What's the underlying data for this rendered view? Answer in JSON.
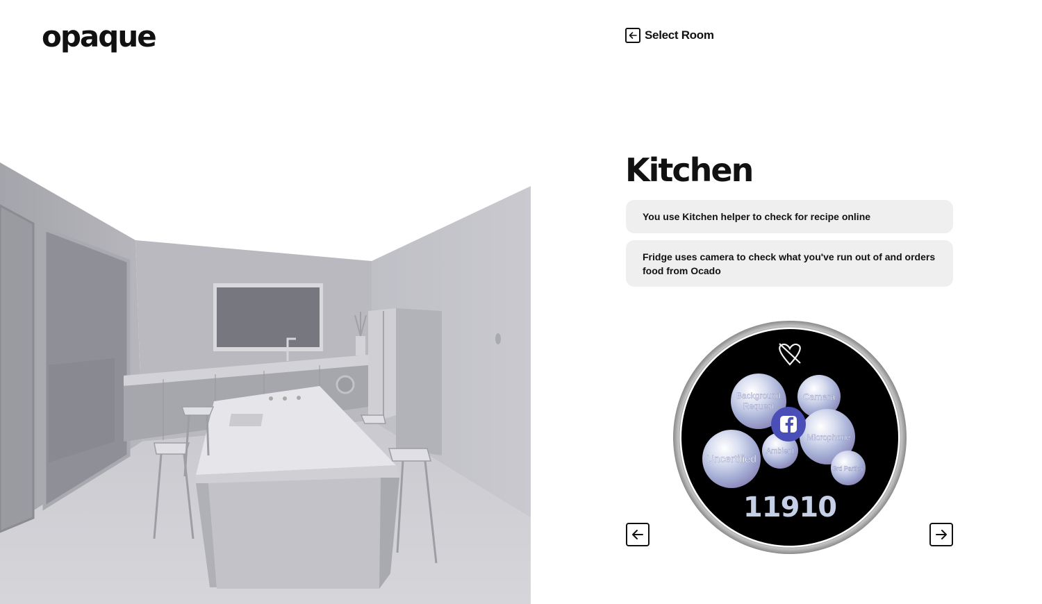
{
  "brand": {
    "logo_text": "opaque"
  },
  "header": {
    "back_label": "Select Room",
    "back_icon": "arrow-left-icon"
  },
  "room": {
    "name": "Kitchen",
    "scenarios": [
      {
        "text": "You use Kitchen helper to check for recipe online"
      },
      {
        "text": "Fridge uses camera to check what you've run out of and orders food from Ocado"
      }
    ]
  },
  "watch": {
    "top_icon": "heart-slash-icon",
    "center_icon": "facebook-icon",
    "bubbles": [
      {
        "label": "Background"
      },
      {
        "label": "Request"
      },
      {
        "label": "Camera"
      },
      {
        "label": "Microphone"
      },
      {
        "label": "Uncertified"
      },
      {
        "label": "Ambient"
      },
      {
        "label": "3rd Parties"
      }
    ],
    "score": "11910"
  },
  "navigation": {
    "prev_icon": "arrow-left-icon",
    "next_icon": "arrow-right-icon"
  },
  "colors": {
    "text": "#111111",
    "card_bg": "#efefef",
    "watch_face": "#000000",
    "score": "#c5d0e6"
  }
}
